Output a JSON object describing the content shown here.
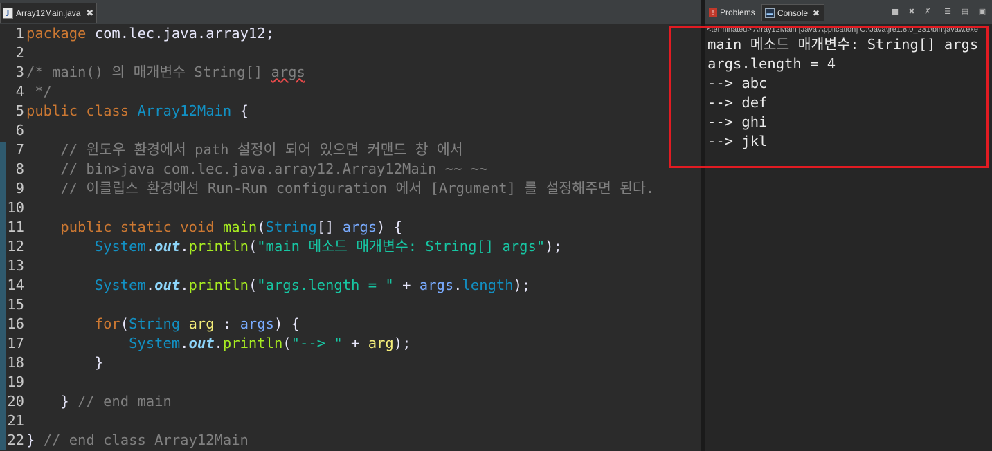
{
  "editor": {
    "tab": {
      "label": "Array12Main.java",
      "close": "✖",
      "icon_letter": "J"
    },
    "lines": [
      {
        "n": "1",
        "segs": [
          {
            "t": "package",
            "c": "kw"
          },
          {
            "t": " com.lec.java.array12;",
            "c": "pl"
          }
        ]
      },
      {
        "n": "2",
        "segs": []
      },
      {
        "n": "3",
        "segs": [
          {
            "t": "/* main() 의 매개변수 String[] ",
            "c": "cm"
          },
          {
            "t": "args",
            "c": "cm squig"
          }
        ]
      },
      {
        "n": "4",
        "segs": [
          {
            "t": " */",
            "c": "cm"
          }
        ]
      },
      {
        "n": "5",
        "segs": [
          {
            "t": "public",
            "c": "kw"
          },
          {
            "t": " ",
            "c": "pl"
          },
          {
            "t": "class",
            "c": "kw"
          },
          {
            "t": " ",
            "c": "pl"
          },
          {
            "t": "Array12Main",
            "c": "cls"
          },
          {
            "t": " {",
            "c": "pl"
          }
        ]
      },
      {
        "n": "6",
        "segs": []
      },
      {
        "n": "7",
        "segs": [
          {
            "t": "    // 윈도우 환경에서 path 설정이 되어 있으면 커맨드 창 에서",
            "c": "cm"
          }
        ]
      },
      {
        "n": "8",
        "segs": [
          {
            "t": "    // bin>java com.lec.java.array12.Array12Main ~~ ~~",
            "c": "cm"
          }
        ]
      },
      {
        "n": "9",
        "segs": [
          {
            "t": "    // 이클립스 환경에선 Run-Run configuration 에서 [Argument] 를 설정해주면 된다.",
            "c": "cm"
          }
        ]
      },
      {
        "n": "10",
        "segs": []
      },
      {
        "n": "11",
        "segs": [
          {
            "t": "    ",
            "c": "pl"
          },
          {
            "t": "public",
            "c": "kw"
          },
          {
            "t": " ",
            "c": "pl"
          },
          {
            "t": "static",
            "c": "kw"
          },
          {
            "t": " ",
            "c": "pl"
          },
          {
            "t": "void",
            "c": "kw"
          },
          {
            "t": " ",
            "c": "pl"
          },
          {
            "t": "main",
            "c": "mt"
          },
          {
            "t": "(",
            "c": "pl"
          },
          {
            "t": "String",
            "c": "ty"
          },
          {
            "t": "[] ",
            "c": "pl"
          },
          {
            "t": "args",
            "c": "par"
          },
          {
            "t": ") {",
            "c": "pl"
          }
        ]
      },
      {
        "n": "12",
        "segs": [
          {
            "t": "        ",
            "c": "pl"
          },
          {
            "t": "System",
            "c": "ty"
          },
          {
            "t": ".",
            "c": "pl"
          },
          {
            "t": "out",
            "c": "fld"
          },
          {
            "t": ".",
            "c": "pl"
          },
          {
            "t": "println",
            "c": "mt"
          },
          {
            "t": "(",
            "c": "pl"
          },
          {
            "t": "\"main 메소드 매개변수: String[] args\"",
            "c": "st"
          },
          {
            "t": ");",
            "c": "pl"
          }
        ]
      },
      {
        "n": "13",
        "segs": []
      },
      {
        "n": "14",
        "segs": [
          {
            "t": "        ",
            "c": "pl"
          },
          {
            "t": "System",
            "c": "ty"
          },
          {
            "t": ".",
            "c": "pl"
          },
          {
            "t": "out",
            "c": "fld"
          },
          {
            "t": ".",
            "c": "pl"
          },
          {
            "t": "println",
            "c": "mt"
          },
          {
            "t": "(",
            "c": "pl"
          },
          {
            "t": "\"args.length = \"",
            "c": "st"
          },
          {
            "t": " + ",
            "c": "pl"
          },
          {
            "t": "args",
            "c": "par"
          },
          {
            "t": ".",
            "c": "pl"
          },
          {
            "t": "length",
            "c": "ty"
          },
          {
            "t": ");",
            "c": "pl"
          }
        ]
      },
      {
        "n": "15",
        "segs": []
      },
      {
        "n": "16",
        "segs": [
          {
            "t": "        ",
            "c": "pl"
          },
          {
            "t": "for",
            "c": "kw"
          },
          {
            "t": "(",
            "c": "pl"
          },
          {
            "t": "String",
            "c": "ty"
          },
          {
            "t": " ",
            "c": "pl"
          },
          {
            "t": "arg",
            "c": "var"
          },
          {
            "t": " : ",
            "c": "pl"
          },
          {
            "t": "args",
            "c": "par"
          },
          {
            "t": ") {",
            "c": "pl"
          }
        ]
      },
      {
        "n": "17",
        "segs": [
          {
            "t": "            ",
            "c": "pl"
          },
          {
            "t": "System",
            "c": "ty"
          },
          {
            "t": ".",
            "c": "pl"
          },
          {
            "t": "out",
            "c": "fld"
          },
          {
            "t": ".",
            "c": "pl"
          },
          {
            "t": "println",
            "c": "mt"
          },
          {
            "t": "(",
            "c": "pl"
          },
          {
            "t": "\"--> \"",
            "c": "st"
          },
          {
            "t": " + ",
            "c": "pl"
          },
          {
            "t": "arg",
            "c": "var"
          },
          {
            "t": ");",
            "c": "pl"
          }
        ]
      },
      {
        "n": "18",
        "segs": [
          {
            "t": "        }",
            "c": "pl"
          }
        ]
      },
      {
        "n": "19",
        "segs": []
      },
      {
        "n": "20",
        "segs": [
          {
            "t": "    } ",
            "c": "pl"
          },
          {
            "t": "// end main",
            "c": "cm"
          }
        ]
      },
      {
        "n": "21",
        "segs": []
      },
      {
        "n": "22",
        "segs": [
          {
            "t": "} ",
            "c": "pl"
          },
          {
            "t": "// end class Array12Main",
            "c": "cm"
          }
        ]
      }
    ]
  },
  "console": {
    "tabs": [
      {
        "label": "Problems"
      },
      {
        "label": "Console",
        "close": "✖"
      }
    ],
    "terminated": "<terminated> Array12Main [Java Application] C:\\Java\\jre1.8.0_231\\bin\\javaw.exe",
    "output": [
      "main 메소드 매개변수: String[] args",
      "args.length = 4",
      "--> abc",
      "--> def",
      "--> ghi",
      "--> jkl"
    ],
    "toolbar_icons": [
      "stop-icon",
      "remove-launch-icon",
      "remove-all-icon",
      "scroll-lock-icon",
      "pin-console-icon",
      "open-console-icon"
    ],
    "highlight_color": "#e11b22"
  }
}
